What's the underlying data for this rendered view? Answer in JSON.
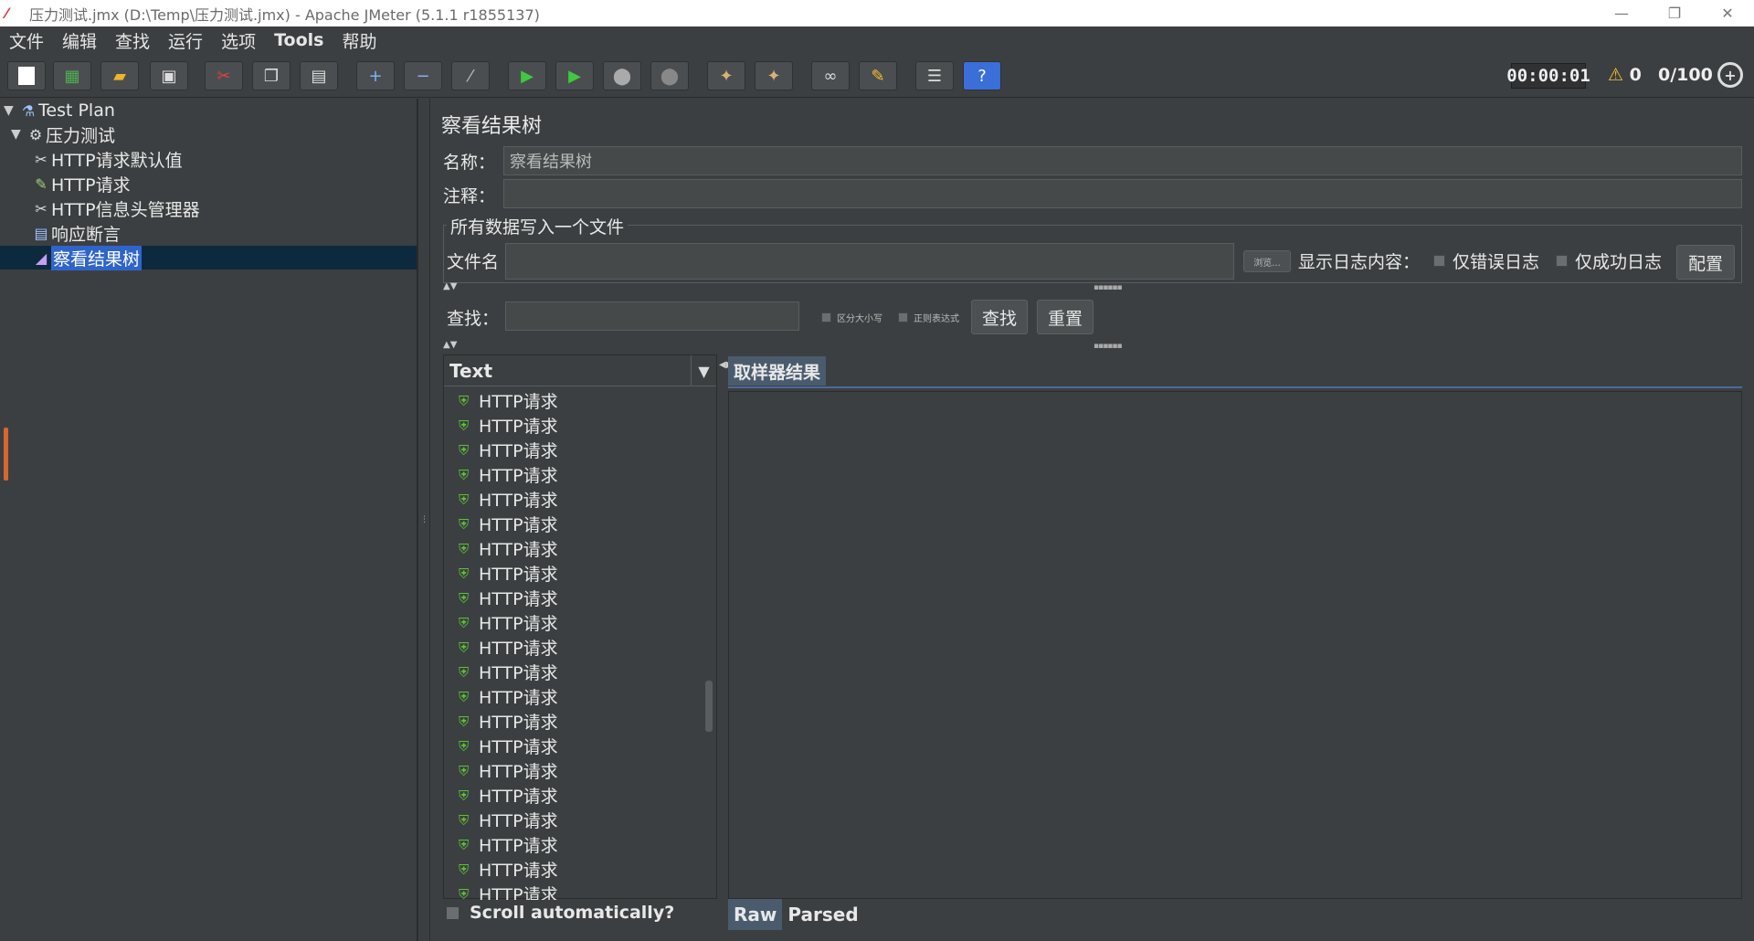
{
  "window": {
    "title": "压力测试.jmx (D:\\Temp\\压力测试.jmx) - Apache JMeter (5.1.1 r1855137)",
    "minimize": "—",
    "restore": "❐",
    "close": "✕"
  },
  "menu": [
    "文件",
    "编辑",
    "查找",
    "运行",
    "选项",
    "Tools",
    "帮助"
  ],
  "toolbar": {
    "timer": "00:00:01",
    "warnings": "0",
    "threads": "0/100"
  },
  "tree": {
    "items": [
      {
        "label": "Test Plan",
        "icon": "flask-icon"
      },
      {
        "label": "压力测试",
        "icon": "gear-icon"
      },
      {
        "label": "HTTP请求默认值",
        "icon": "scissors-icon"
      },
      {
        "label": "HTTP请求",
        "icon": "pen-icon"
      },
      {
        "label": "HTTP信息头管理器",
        "icon": "scissors-icon"
      },
      {
        "label": "响应断言",
        "icon": "assertion-icon"
      },
      {
        "label": "察看结果树",
        "icon": "chart-icon"
      }
    ],
    "selected": "察看结果树"
  },
  "panel": {
    "title": "察看结果树",
    "name_label": "名称：",
    "name_value": "察看结果树",
    "comment_label": "注释：",
    "comment_value": "",
    "file_group_title": "所有数据写入一个文件",
    "filename_label": "文件名",
    "filename_value": "",
    "browse_label": "浏览...",
    "log_display_label": "显示日志内容：",
    "errors_only_label": "仅错误日志",
    "success_only_label": "仅成功日志",
    "config_label": "配置",
    "search_label": "查找：",
    "search_value": "",
    "case_sensitive_label": "区分大小写",
    "regex_label": "正则表达式",
    "search_button": "查找",
    "reset_button": "重置"
  },
  "results": {
    "column_header": "Text",
    "items": [
      "HTTP请求",
      "HTTP请求",
      "HTTP请求",
      "HTTP请求",
      "HTTP请求",
      "HTTP请求",
      "HTTP请求",
      "HTTP请求",
      "HTTP请求",
      "HTTP请求",
      "HTTP请求",
      "HTTP请求",
      "HTTP请求",
      "HTTP请求",
      "HTTP请求",
      "HTTP请求",
      "HTTP请求",
      "HTTP请求",
      "HTTP请求",
      "HTTP请求",
      "HTTP请求"
    ],
    "scroll_auto_label": "Scroll automatically?",
    "sampler_tab": "取样器结果",
    "raw_tab": "Raw",
    "parsed_tab": "Parsed"
  }
}
